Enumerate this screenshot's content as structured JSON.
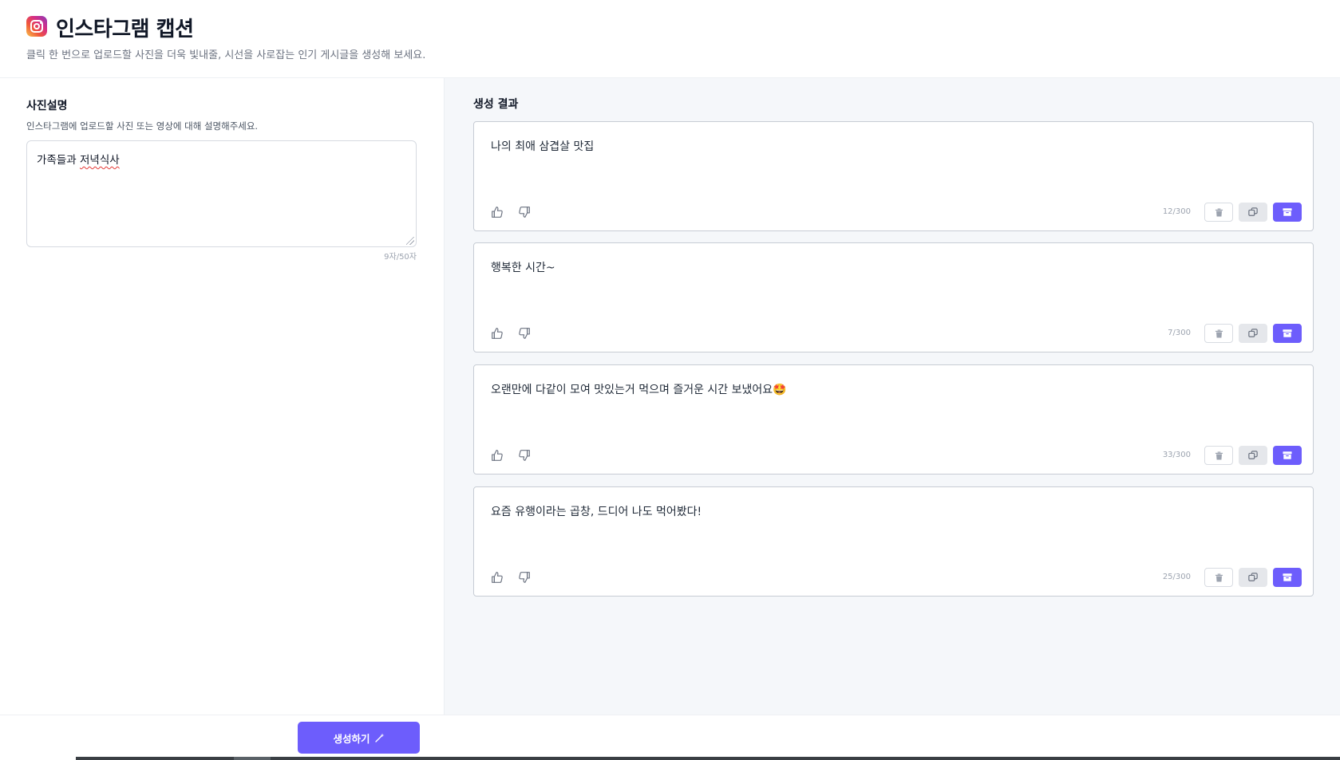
{
  "header": {
    "title": "인스타그램 캡션",
    "subtitle": "클릭 한 번으로 업로드할 사진을 더욱 빛내줄, 시선을 사로잡는 인기 게시글을 생성해 보세요.",
    "logo_icon": "instagram-icon"
  },
  "input": {
    "section_title": "사진설명",
    "description": "인스타그램에 업로드할 사진 또는 영상에 대해 설명해주세요.",
    "value_prefix": "가족들과 ",
    "value_misspelled": "저녁식사",
    "counter": "9자/50자"
  },
  "results": {
    "section_title": "생성 결과",
    "cards": [
      {
        "text": "나의 최애 삼겹살 맛집",
        "length": "12/300"
      },
      {
        "text": "행복한 시간~",
        "length": "7/300"
      },
      {
        "text": "오랜만에 다같이 모여 맛있는거 먹으며 즐거운 시간 보냈어요🤩",
        "length": "33/300"
      },
      {
        "text": "요즘 유행이라는 곱창, 드디어 나도 먹어봤다!",
        "length": "25/300"
      }
    ]
  },
  "footer": {
    "generate_label": "생성하기",
    "generate_icon": "magic-wand-icon"
  },
  "colors": {
    "accent": "#6d5dfc",
    "panel_bg": "#f5f7fa"
  }
}
